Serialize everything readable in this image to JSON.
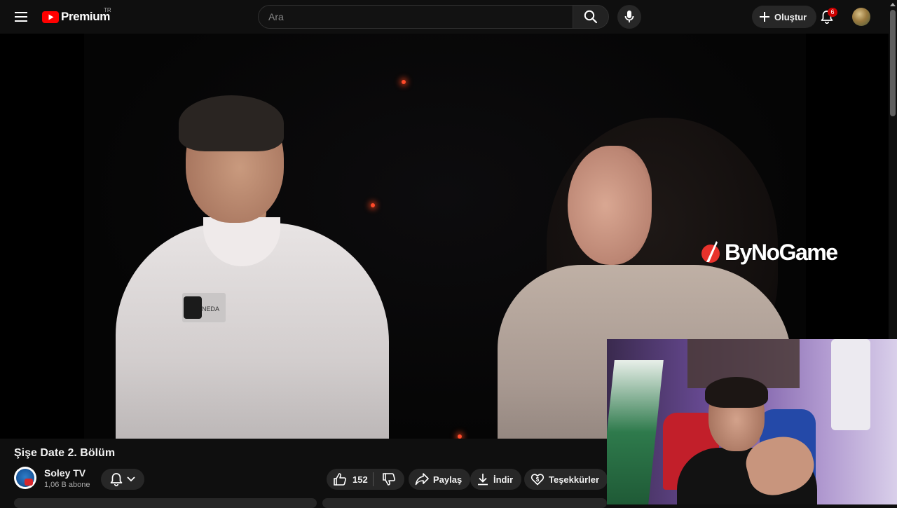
{
  "header": {
    "logo_text": "Premium",
    "country_code": "TR",
    "search_placeholder": "Ara",
    "create_label": "Oluştur",
    "notification_count": "6"
  },
  "player": {
    "name_tag": "NEDA",
    "sponsor_logo_text": "ByNoGame"
  },
  "video": {
    "title": "Şişe Date 2. Bölüm",
    "channel_name": "Soley TV",
    "subscribers": "1,06 B abone",
    "likes": "152",
    "share_label": "Paylaş",
    "download_label": "İndir",
    "thanks_label": "Teşekkürler"
  },
  "icons": {
    "menu": "hamburger-icon",
    "logo": "youtube-play-icon",
    "search": "search-icon",
    "mic": "microphone-icon",
    "create": "plus-icon",
    "notifications": "bell-icon",
    "like": "thumbs-up-icon",
    "dislike": "thumbs-down-icon",
    "share": "share-arrow-icon",
    "download": "download-icon",
    "thanks": "heart-dollar-icon"
  },
  "colors": {
    "background": "#0f0f0f",
    "button_bg": "#272727",
    "brand_red": "#ff0000",
    "badge_red": "#cc0000",
    "text_primary": "#f1f1f1",
    "text_secondary": "#aaaaaa"
  }
}
